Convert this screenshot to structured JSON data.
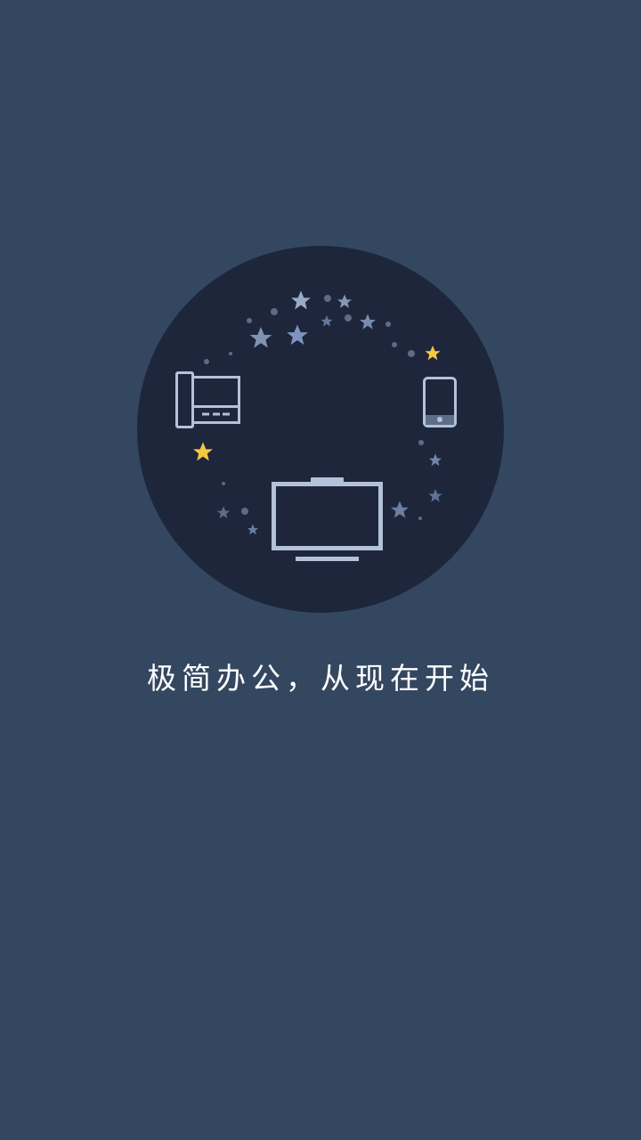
{
  "splash": {
    "tagline": "极简办公，从现在开始",
    "illustration": {
      "icons": [
        "desk-phone-icon",
        "smartphone-icon",
        "monitor-icon",
        "star-icon"
      ]
    }
  },
  "colors": {
    "background": "#344760",
    "circle": "#1d263b",
    "device_line": "#b4c2d9",
    "star_blue": "#7d93b8",
    "star_gold": "#f5c842",
    "text": "#ffffff"
  }
}
